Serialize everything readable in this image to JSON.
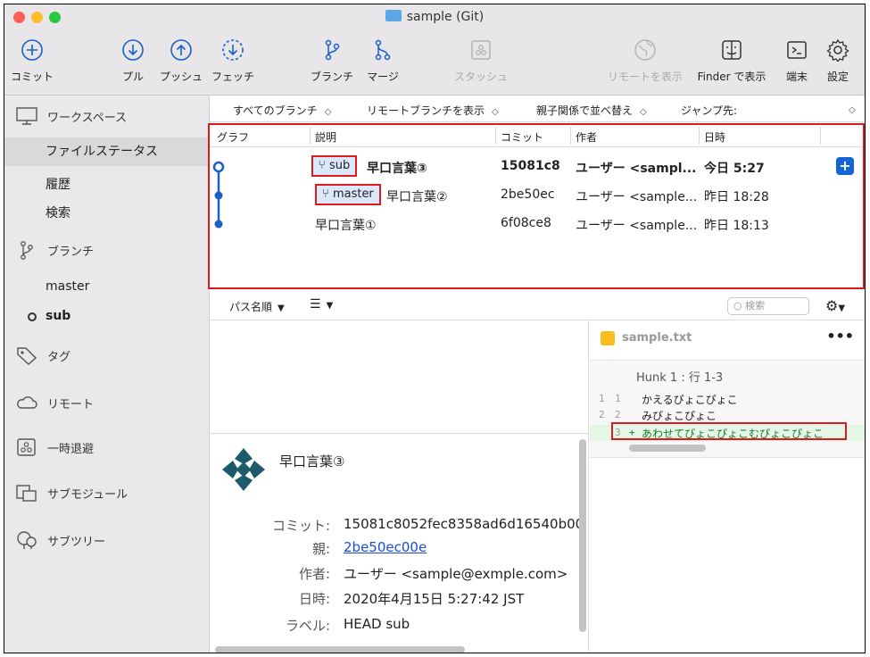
{
  "window": {
    "title": "sample (Git)"
  },
  "toolbar": {
    "commit": "コミット",
    "pull": "プル",
    "push": "プッシュ",
    "fetch": "フェッチ",
    "branch": "ブランチ",
    "merge": "マージ",
    "stash": "スタッシュ",
    "remote_view": "リモートを表示",
    "finder": "Finder で表示",
    "terminal": "端末",
    "settings": "設定"
  },
  "sidebar": {
    "workspace": "ワークスペース",
    "file_status": "ファイルステータス",
    "history": "履歴",
    "search": "検索",
    "branches": "ブランチ",
    "branch_master": "master",
    "branch_sub": "sub",
    "tags": "タグ",
    "remotes": "リモート",
    "stashes": "一時退避",
    "submodules": "サブモジュール",
    "subtrees": "サブツリー"
  },
  "branchbar": {
    "all_branches": "すべてのブランチ",
    "show_remote": "リモートブランチを表示",
    "sort_parent": "親子関係で並べ替え",
    "jump": "ジャンプ先:"
  },
  "commit_list": {
    "headers": {
      "graph": "グラフ",
      "desc": "説明",
      "commit": "コミット",
      "author": "作者",
      "date": "日時"
    },
    "rows": [
      {
        "tag": "sub",
        "desc": "早口言葉③",
        "hash": "15081c8",
        "author": "ユーザー <sampl...",
        "date": "今日 5:27"
      },
      {
        "tag": "master",
        "desc": "早口言葉②",
        "hash": "2be50ec",
        "author": "ユーザー <sample...",
        "date": "昨日 18:28"
      },
      {
        "tag": "",
        "desc": "早口言葉①",
        "hash": "6f08ce8",
        "author": "ユーザー <sample...",
        "date": "昨日 18:13"
      }
    ]
  },
  "filebar": {
    "path_sort": "パス名順",
    "search_placeholder": "検索"
  },
  "detail": {
    "title": "早口言葉③",
    "commit_label": "コミット:",
    "commit_value": "15081c8052fec8358ad6d16540b00",
    "parent_label": "親:",
    "parent_value": "2be50ec00e",
    "author_label": "作者:",
    "author_value": "ユーザー <sample@exmple.com>",
    "date_label": "日時:",
    "date_value": "2020年4月15日 5:27:42 JST",
    "label_label": "ラベル:",
    "label_value": "HEAD sub"
  },
  "diff": {
    "filename": "sample.txt",
    "hunk": "Hunk 1 : 行 1-3",
    "lines": [
      {
        "old": "1",
        "new": "1",
        "sign": "",
        "text": "かえるぴょこぴょこ"
      },
      {
        "old": "2",
        "new": "2",
        "sign": "",
        "text": "みぴょこぴょこ"
      },
      {
        "old": "",
        "new": "3",
        "sign": "+",
        "text": "あわせてぴょこぴょこむぴょこぴょこ"
      }
    ]
  },
  "colors": {
    "accent": "#1464d8",
    "highlight": "#e0191c",
    "graph": "#1a5fc7"
  }
}
